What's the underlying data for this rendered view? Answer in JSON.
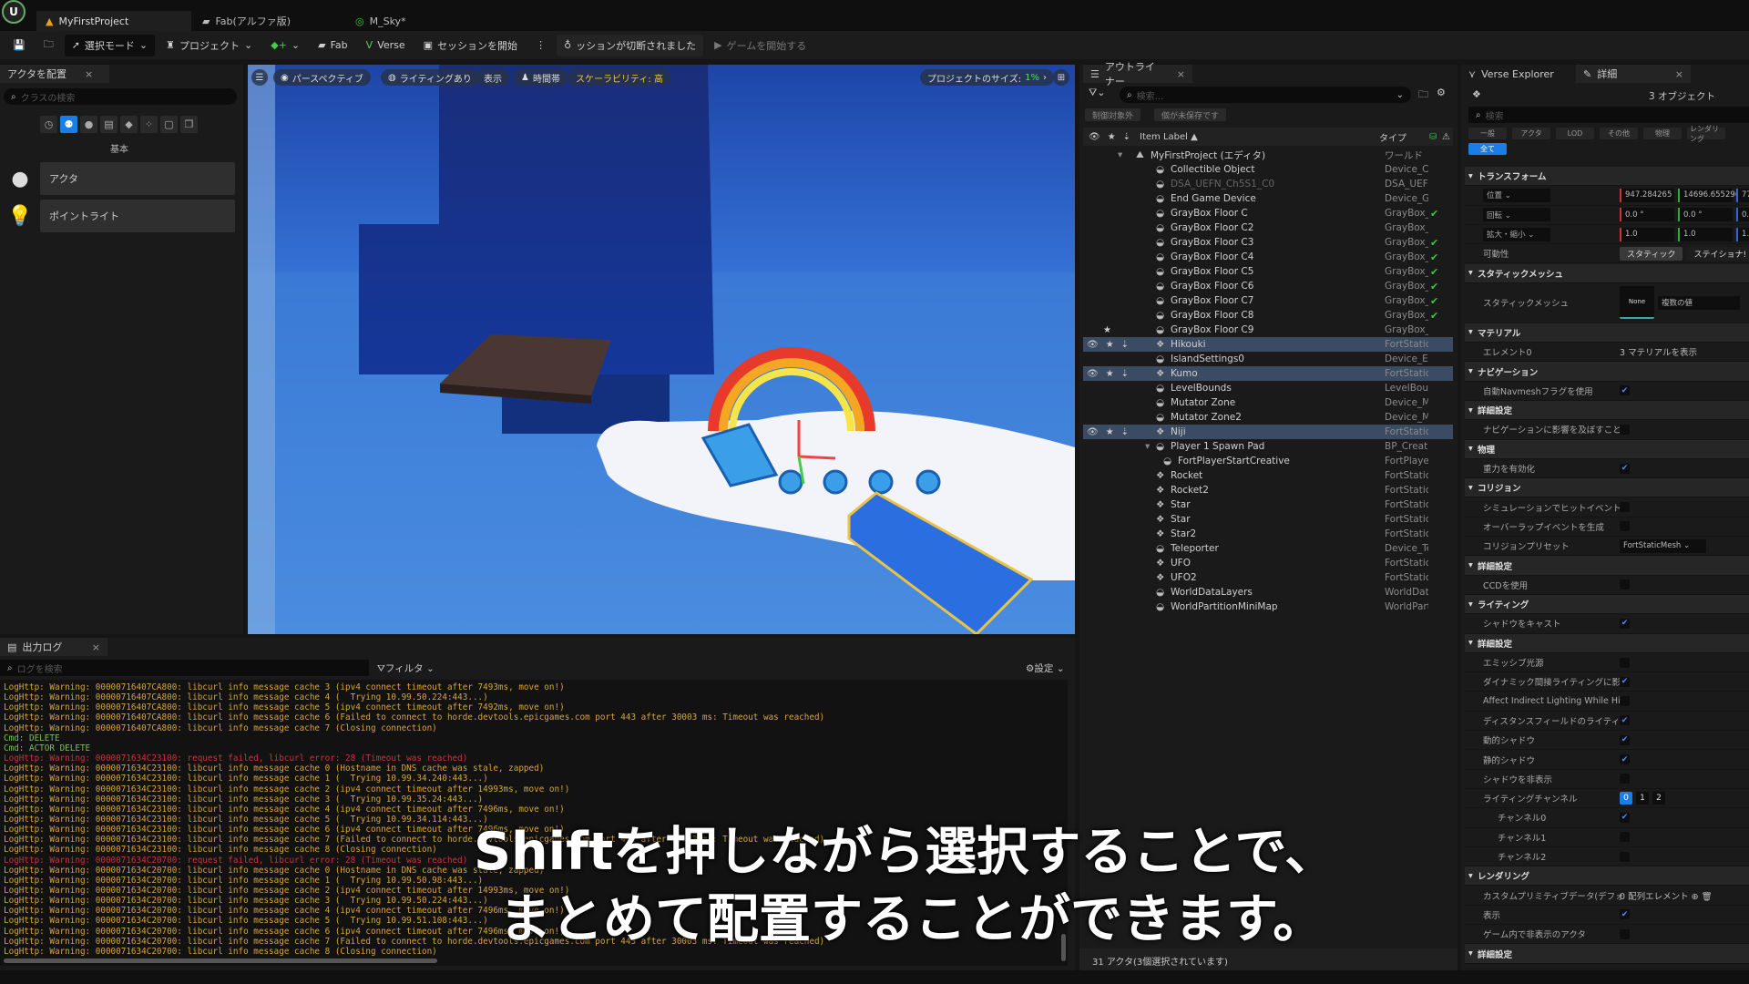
{
  "app": {
    "tabs": [
      {
        "label": "MyFirstProject",
        "icon": "level-icon"
      },
      {
        "label": "Fab(アルファ版)",
        "icon": "fab-icon"
      },
      {
        "label": "M_Sky*",
        "icon": "material-icon"
      }
    ]
  },
  "toolbar": {
    "mode": "選択モード",
    "project": "プロジェクト",
    "fab": "Fab",
    "verse": "Verse",
    "session": "セッションを開始",
    "disconnected": "ッションが切断されました",
    "play": "ゲームを開始する"
  },
  "place_actors": {
    "tab": "アクタを配置",
    "search_placeholder": "クラスの検索",
    "category": "基本",
    "items": [
      {
        "label": "アクタ",
        "icon": "actor-sphere-icon"
      },
      {
        "label": "ポイントライト",
        "icon": "point-light-icon"
      }
    ]
  },
  "viewport": {
    "perspective": "パースペクティブ",
    "lighting": "ライティングあり",
    "show": "表示",
    "time": "時間帯",
    "scalability": "スケーラビリティ: 高",
    "project_size_label": "プロジェクトのサイズ:",
    "project_size_value": "1%"
  },
  "outliner": {
    "tab": "アウトライナー",
    "search_placeholder": "検索...",
    "filter1": "制御対象外",
    "filter2": "個が未保存です",
    "col_label": "Item Label",
    "col_type": "タイプ",
    "status": "31 アクタ(3個選択されています)",
    "rows": [
      {
        "label": "MyFirstProject (エディタ)",
        "type": "ワールド",
        "indent": 0,
        "root": true
      },
      {
        "label": "Collectible Object",
        "type": "Device_Cc",
        "indent": 1
      },
      {
        "label": "DSA_UEFN_Ch5S1_C0",
        "type": "DSA_UEFI",
        "indent": 1,
        "dim": true
      },
      {
        "label": "End Game Device",
        "type": "Device_Ga",
        "indent": 1
      },
      {
        "label": "GrayBox Floor C",
        "type": "GrayBox_l",
        "indent": 1,
        "check": true
      },
      {
        "label": "GrayBox Floor C2",
        "type": "GrayBox_l",
        "indent": 1
      },
      {
        "label": "GrayBox Floor C3",
        "type": "GrayBox_l",
        "indent": 1,
        "check": true
      },
      {
        "label": "GrayBox Floor C4",
        "type": "GrayBox_l",
        "indent": 1,
        "check": true
      },
      {
        "label": "GrayBox Floor C5",
        "type": "GrayBox_l",
        "indent": 1,
        "check": true
      },
      {
        "label": "GrayBox Floor C6",
        "type": "GrayBox_l",
        "indent": 1,
        "check": true
      },
      {
        "label": "GrayBox Floor C7",
        "type": "GrayBox_l",
        "indent": 1,
        "check": true
      },
      {
        "label": "GrayBox Floor C8",
        "type": "GrayBox_l",
        "indent": 1,
        "check": true
      },
      {
        "label": "GrayBox Floor C9",
        "type": "GrayBox_l",
        "indent": 1,
        "star": true
      },
      {
        "label": "Hikouki",
        "type": "FortStatic",
        "indent": 1,
        "selected": true
      },
      {
        "label": "IslandSettings0",
        "type": "Device_Ex",
        "indent": 1
      },
      {
        "label": "Kumo",
        "type": "FortStatic",
        "indent": 1,
        "selected": true
      },
      {
        "label": "LevelBounds",
        "type": "LevelBour",
        "indent": 1
      },
      {
        "label": "Mutator Zone",
        "type": "Device_Mi",
        "indent": 1
      },
      {
        "label": "Mutator Zone2",
        "type": "Device_Mi",
        "indent": 1
      },
      {
        "label": "Niji",
        "type": "FortStatic",
        "indent": 1,
        "selected": true
      },
      {
        "label": "Player 1 Spawn Pad",
        "type": "BP_Creati",
        "indent": 1,
        "expanded": true
      },
      {
        "label": "FortPlayerStartCreative",
        "type": "FortPlayer",
        "indent": 2
      },
      {
        "label": "Rocket",
        "type": "FortStatic",
        "indent": 1
      },
      {
        "label": "Rocket2",
        "type": "FortStatic",
        "indent": 1
      },
      {
        "label": "Star",
        "type": "FortStatic",
        "indent": 1
      },
      {
        "label": "Star",
        "type": "FortStatic",
        "indent": 1
      },
      {
        "label": "Star2",
        "type": "FortStatic",
        "indent": 1
      },
      {
        "label": "Teleporter",
        "type": "Device_Te",
        "indent": 1
      },
      {
        "label": "UFO",
        "type": "FortStatic",
        "indent": 1
      },
      {
        "label": "UFO2",
        "type": "FortStatic",
        "indent": 1
      },
      {
        "label": "WorldDataLayers",
        "type": "WorldDatu",
        "indent": 1
      },
      {
        "label": "WorldPartitionMiniMap",
        "type": "WorldPart",
        "indent": 1
      }
    ]
  },
  "details": {
    "tab_verse": "Verse Explorer",
    "tab": "詳細",
    "object_count": "3 オブジェクト",
    "search_placeholder": "検索",
    "filters": [
      "一般",
      "アクタ",
      "LOD",
      "その他",
      "物理",
      "レンダリング",
      "全て"
    ],
    "active_filter": "全て",
    "rows": [
      {
        "kind": "sec",
        "label": "トランスフォーム"
      },
      {
        "kind": "vec",
        "label": "位置",
        "values": [
          "947.284265",
          "14696.65529(",
          "77"
        ]
      },
      {
        "kind": "vec",
        "label": "回転",
        "values": [
          "0.0 °",
          "0.0 °",
          "0.0"
        ]
      },
      {
        "kind": "vec",
        "label": "拡大・縮小",
        "values": [
          "1.0",
          "1.0",
          "1.0"
        ]
      },
      {
        "kind": "mob",
        "label": "可動性",
        "values": [
          "スタティック",
          "ステイショナ!"
        ]
      },
      {
        "kind": "sec",
        "label": "スタティックメッシュ"
      },
      {
        "kind": "mesh",
        "label": "スタティックメッシュ",
        "values": [
          "None",
          "複数の値"
        ]
      },
      {
        "kind": "sec",
        "label": "マテリアル"
      },
      {
        "kind": "text",
        "label": "エレメント0",
        "value": "3 マテリアルを表示"
      },
      {
        "kind": "sec",
        "label": "ナビゲーション"
      },
      {
        "kind": "cb",
        "label": "自動Navmeshフラグを使用",
        "checked": true
      },
      {
        "kind": "sec",
        "label": "詳細設定"
      },
      {
        "kind": "cb",
        "label": "ナビゲーションに影響を及ぼすこと...",
        "checked": false
      },
      {
        "kind": "sec",
        "label": "物理"
      },
      {
        "kind": "cb",
        "label": "重力を有効化",
        "checked": true
      },
      {
        "kind": "sec",
        "label": "コリジョン"
      },
      {
        "kind": "cb",
        "label": "シミュレーションでヒットイベントを...",
        "checked": false
      },
      {
        "kind": "cb",
        "label": "オーバーラップイベントを生成",
        "checked": false
      },
      {
        "kind": "drop",
        "label": "コリジョンプリセット",
        "value": "FortStaticMesh"
      },
      {
        "kind": "sec",
        "label": "詳細設定"
      },
      {
        "kind": "cb",
        "label": "CCDを使用",
        "checked": false
      },
      {
        "kind": "sec",
        "label": "ライティング"
      },
      {
        "kind": "cb",
        "label": "シャドウをキャスト",
        "checked": true
      },
      {
        "kind": "sec",
        "label": "詳細設定"
      },
      {
        "kind": "cb",
        "label": "エミッシブ光源",
        "checked": false
      },
      {
        "kind": "cb",
        "label": "ダイナミック間接ライティングに影響...",
        "checked": true
      },
      {
        "kind": "cb",
        "label": "Affect Indirect Lighting While Hidden",
        "checked": false
      },
      {
        "kind": "cb",
        "label": "ディスタンスフィールドのライティン...",
        "checked": true
      },
      {
        "kind": "cb",
        "label": "動的シャドウ",
        "checked": true
      },
      {
        "kind": "cb",
        "label": "静的シャドウ",
        "checked": true
      },
      {
        "kind": "cb",
        "label": "シャドウを非表示",
        "checked": false
      },
      {
        "kind": "chan",
        "label": "ライティングチャンネル",
        "values": [
          "0",
          "1",
          "2"
        ]
      },
      {
        "kind": "cb",
        "label": "チャンネル0",
        "checked": true,
        "sub": true
      },
      {
        "kind": "cb",
        "label": "チャンネル1",
        "checked": false,
        "sub": true
      },
      {
        "kind": "cb",
        "label": "チャンネル2",
        "checked": false,
        "sub": true
      },
      {
        "kind": "sec",
        "label": "レンダリング"
      },
      {
        "kind": "text",
        "label": "カスタムプリミティブデータ(デフォルト)",
        "value": "0 配列エレメント ⊕ 🗑"
      },
      {
        "kind": "cb",
        "label": "表示",
        "checked": true
      },
      {
        "kind": "cb",
        "label": "ゲーム内で非表示のアクタ",
        "checked": false
      },
      {
        "kind": "sec",
        "label": "詳細設定"
      }
    ]
  },
  "output_log": {
    "tab": "出力ログ",
    "search_placeholder": "ログを検索",
    "filter": "フィルタ",
    "settings": "設定",
    "lines": [
      {
        "t": "LogHttp: Warning: 00000716407CA800: libcurl info message cache 3 (ipv4 connect timeout after 7493ms, move on!)"
      },
      {
        "t": "LogHttp: Warning: 00000716407CA800: libcurl info message cache 4 (  Trying 10.99.50.224:443...)"
      },
      {
        "t": "LogHttp: Warning: 00000716407CA800: libcurl info message cache 5 (ipv4 connect timeout after 7492ms, move on!)"
      },
      {
        "t": "LogHttp: Warning: 00000716407CA800: libcurl info message cache 6 (Failed to connect to horde.devtools.epicgames.com port 443 after 30003 ms: Timeout was reached)"
      },
      {
        "t": "LogHttp: Warning: 00000716407CA800: libcurl info message cache 7 (Closing connection)"
      },
      {
        "t": "Cmd: DELETE",
        "c": "cmd"
      },
      {
        "t": "Cmd: ACTOR DELETE",
        "c": "cmd"
      },
      {
        "t": "LogHttp: Warning: 0000071634C23100: request failed, libcurl error: 28 (Timeout was reached)",
        "c": "err"
      },
      {
        "t": "LogHttp: Warning: 0000071634C23100: libcurl info message cache 0 (Hostname in DNS cache was stale, zapped)"
      },
      {
        "t": "LogHttp: Warning: 0000071634C23100: libcurl info message cache 1 (  Trying 10.99.34.240:443...)"
      },
      {
        "t": "LogHttp: Warning: 0000071634C23100: libcurl info message cache 2 (ipv4 connect timeout after 14993ms, move on!)"
      },
      {
        "t": "LogHttp: Warning: 0000071634C23100: libcurl info message cache 3 (  Trying 10.99.35.24:443...)"
      },
      {
        "t": "LogHttp: Warning: 0000071634C23100: libcurl info message cache 4 (ipv4 connect timeout after 7496ms, move on!)"
      },
      {
        "t": "LogHttp: Warning: 0000071634C23100: libcurl info message cache 5 (  Trying 10.99.34.114:443...)"
      },
      {
        "t": "LogHttp: Warning: 0000071634C23100: libcurl info message cache 6 (ipv4 connect timeout after 7496ms, move on!)"
      },
      {
        "t": "LogHttp: Warning: 0000071634C23100: libcurl info message cache 7 (Failed to connect to horde.devtools.epicgames.com port 443 after 30003 ms: Timeout was reached)"
      },
      {
        "t": "LogHttp: Warning: 0000071634C23100: libcurl info message cache 8 (Closing connection)"
      },
      {
        "t": "LogHttp: Warning: 0000071634C20700: request failed, libcurl error: 28 (Timeout was reached)",
        "c": "err"
      },
      {
        "t": "LogHttp: Warning: 0000071634C20700: libcurl info message cache 0 (Hostname in DNS cache was stale, zapped)"
      },
      {
        "t": "LogHttp: Warning: 0000071634C20700: libcurl info message cache 1 (  Trying 10.99.50.98:443...)"
      },
      {
        "t": "LogHttp: Warning: 0000071634C20700: libcurl info message cache 2 (ipv4 connect timeout after 14993ms, move on!)"
      },
      {
        "t": "LogHttp: Warning: 0000071634C20700: libcurl info message cache 3 (  Trying 10.99.50.224:443...)"
      },
      {
        "t": "LogHttp: Warning: 0000071634C20700: libcurl info message cache 4 (ipv4 connect timeout after 7496ms, move on!)"
      },
      {
        "t": "LogHttp: Warning: 0000071634C20700: libcurl info message cache 5 (  Trying 10.99.51.108:443...)"
      },
      {
        "t": "LogHttp: Warning: 0000071634C20700: libcurl info message cache 6 (ipv4 connect timeout after 7496ms, move on!)"
      },
      {
        "t": "LogHttp: Warning: 0000071634C20700: libcurl info message cache 7 (Failed to connect to horde.devtools.epicgames.com port 443 after 30003 ms: Timeout was reached)"
      },
      {
        "t": "LogHttp: Warning: 0000071634C20700: libcurl info message cache 8 (Closing connection)"
      }
    ]
  },
  "subtitle": {
    "line1": "Shiftを押しながら選択することで、",
    "line2": "まとめて配置することができます。"
  },
  "colors": {
    "accent": "#1a7ee8",
    "selected_row": "#3a4b63",
    "log_warning": "#d9a53a",
    "log_error": "#c9363d",
    "log_cmd": "#7fbf5a",
    "check_green": "#3fc24a"
  }
}
